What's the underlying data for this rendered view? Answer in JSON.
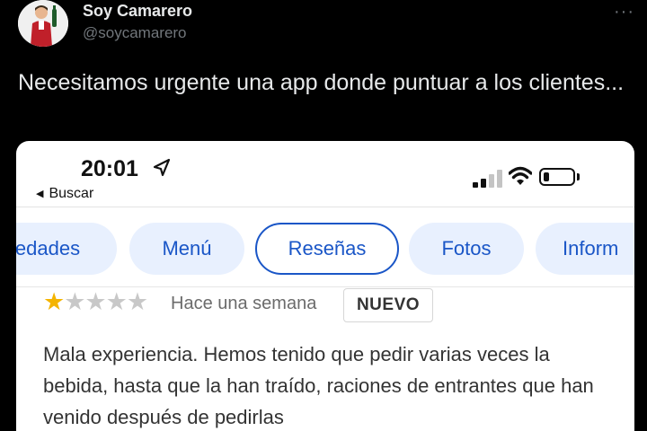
{
  "tweet": {
    "author_name": "Soy Camarero",
    "author_handle": "@soycamarero",
    "more_label": "···",
    "text": "Necesitamos urgente una app donde puntuar a los clientes..."
  },
  "phone": {
    "status_time": "20:01",
    "back_label": "Buscar",
    "back_icon": "left-triangle",
    "nav_icon": "location-arrow-icon",
    "battery_level": 0.2
  },
  "tabs": [
    {
      "label": "edades",
      "active": false
    },
    {
      "label": "Menú",
      "active": false
    },
    {
      "label": "Reseñas",
      "active": true
    },
    {
      "label": "Fotos",
      "active": false
    },
    {
      "label": "Inform",
      "active": false
    }
  ],
  "review": {
    "rating": 1,
    "rating_max": 5,
    "stars_on": "★",
    "stars_off": "★★★★",
    "date": "Hace una semana",
    "badge": "NUEVO",
    "body": "Mala experiencia. Hemos tenido que pedir varias veces la bebida, hasta que la han traído, raciones de entrantes que han venido después de pedirlas"
  },
  "colors": {
    "background": "#000000",
    "accent_blue": "#1a56c7",
    "tab_fill": "#e8f0fe",
    "star_on": "#f4b400",
    "star_off": "#c8c8c8"
  }
}
